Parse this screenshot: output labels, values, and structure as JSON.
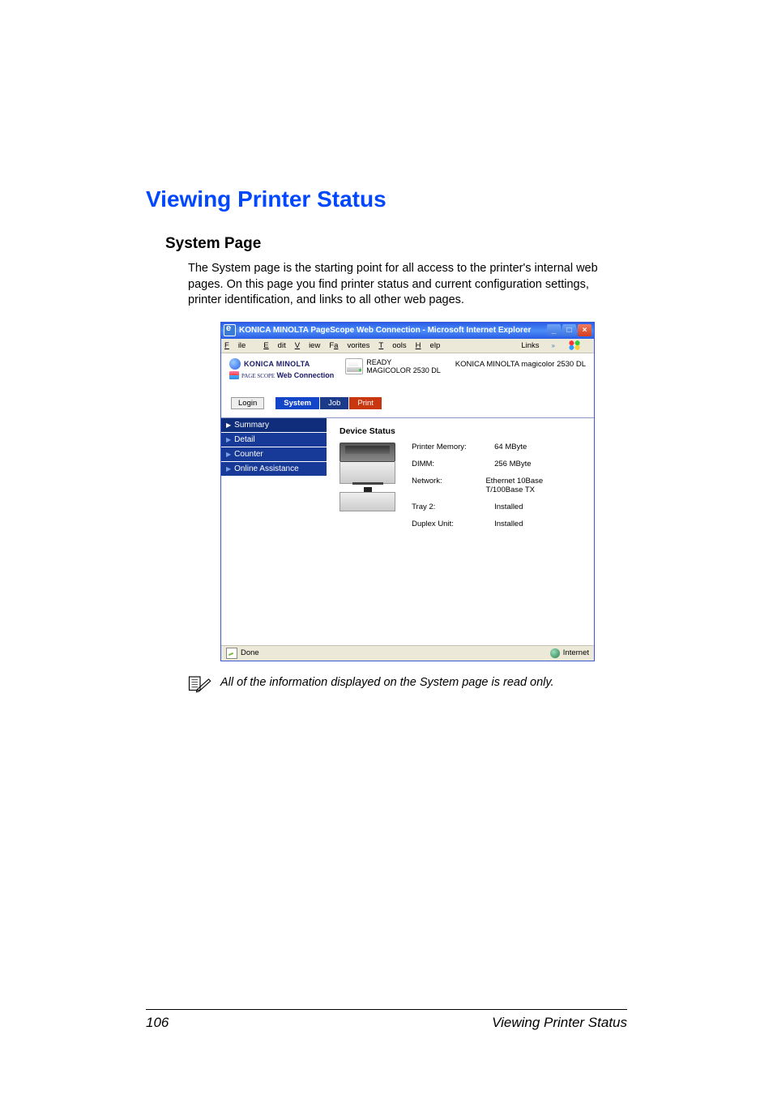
{
  "doc": {
    "heading1": "Viewing Printer Status",
    "heading2": "System Page",
    "body": "The System page is the starting point for all access to the printer's internal web pages. On this page you find printer status and current configuration settings, printer identification, and links to all other web pages.",
    "note": "All of the information displayed on the System page is read only.",
    "footer_page": "106",
    "footer_text": "Viewing Printer Status"
  },
  "ie": {
    "title": "KONICA MINOLTA PageScope Web Connection - Microsoft Internet Explorer",
    "menu": {
      "file": "File",
      "edit": "Edit",
      "view": "View",
      "favorites": "Favorites",
      "tools": "Tools",
      "help": "Help",
      "links": "Links"
    },
    "status_done": "Done",
    "status_zone": "Internet"
  },
  "ps": {
    "brand1": "KONICA MINOLTA",
    "brand2_prefix": "PAGE SCOPE",
    "brand2": "Web Connection",
    "ready": "READY",
    "model": "MAGICOLOR 2530 DL",
    "header_right": "KONICA MINOLTA magicolor 2530 DL",
    "login": "Login",
    "tabs": {
      "system": "System",
      "job": "Job",
      "print": "Print"
    },
    "sidebar": {
      "summary": "Summary",
      "detail": "Detail",
      "counter": "Counter",
      "assist": "Online Assistance"
    },
    "section_title": "Device Status",
    "kv": {
      "mem_k": "Printer Memory:",
      "mem_v": "64 MByte",
      "dimm_k": "DIMM:",
      "dimm_v": "256 MByte",
      "net_k": "Network:",
      "net_v": "Ethernet 10Base T/100Base TX",
      "tray_k": "Tray 2:",
      "tray_v": "Installed",
      "dup_k": "Duplex Unit:",
      "dup_v": "Installed"
    }
  }
}
